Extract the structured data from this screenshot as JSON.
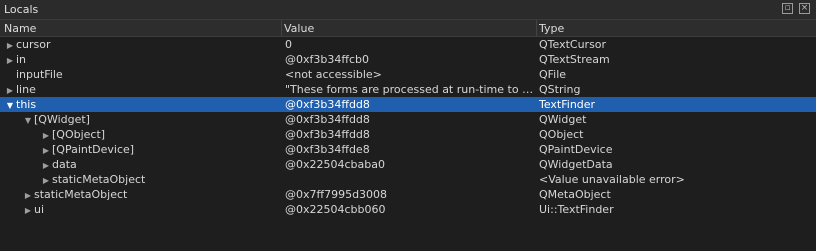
{
  "panel": {
    "title": "Locals",
    "icons": [
      "float-icon",
      "close-icon"
    ]
  },
  "columns": {
    "name": "Name",
    "value": "Value",
    "type": "Type"
  },
  "rows": [
    {
      "name": "cursor",
      "value": "0",
      "type": "QTextCursor",
      "depth": 0,
      "expander": "collapsed"
    },
    {
      "name": "in",
      "value": "@0xf3b34ffcb0",
      "type": "QTextStream",
      "depth": 0,
      "expander": "collapsed"
    },
    {
      "name": "inputFile",
      "value": "<not accessible>",
      "type": "QFile",
      "depth": 0,
      "expander": "none"
    },
    {
      "name": "line",
      "value": "\"These forms are processed at run-time to pr...",
      "type": "QString",
      "depth": 0,
      "expander": "collapsed"
    },
    {
      "name": "this",
      "value": "@0xf3b34ffdd8",
      "type": "TextFinder",
      "depth": 0,
      "expander": "expanded",
      "selected": true
    },
    {
      "name": "[QWidget]",
      "value": "@0xf3b34ffdd8",
      "type": "QWidget",
      "depth": 1,
      "expander": "expanded"
    },
    {
      "name": "[QObject]",
      "value": "@0xf3b34ffdd8",
      "type": "QObject",
      "depth": 2,
      "expander": "collapsed"
    },
    {
      "name": "[QPaintDevice]",
      "value": "@0xf3b34ffde8",
      "type": "QPaintDevice",
      "depth": 2,
      "expander": "collapsed"
    },
    {
      "name": "data",
      "value": "@0x22504cbaba0",
      "type": "QWidgetData",
      "depth": 2,
      "expander": "collapsed"
    },
    {
      "name": "staticMetaObject",
      "value": "",
      "type": "<Value unavailable error>",
      "depth": 2,
      "expander": "collapsed"
    },
    {
      "name": "staticMetaObject",
      "value": "@0x7ff7995d3008",
      "type": "QMetaObject",
      "depth": 1,
      "expander": "collapsed"
    },
    {
      "name": "ui",
      "value": "@0x22504cbb060",
      "type": "Ui::TextFinder",
      "depth": 1,
      "expander": "collapsed"
    }
  ]
}
